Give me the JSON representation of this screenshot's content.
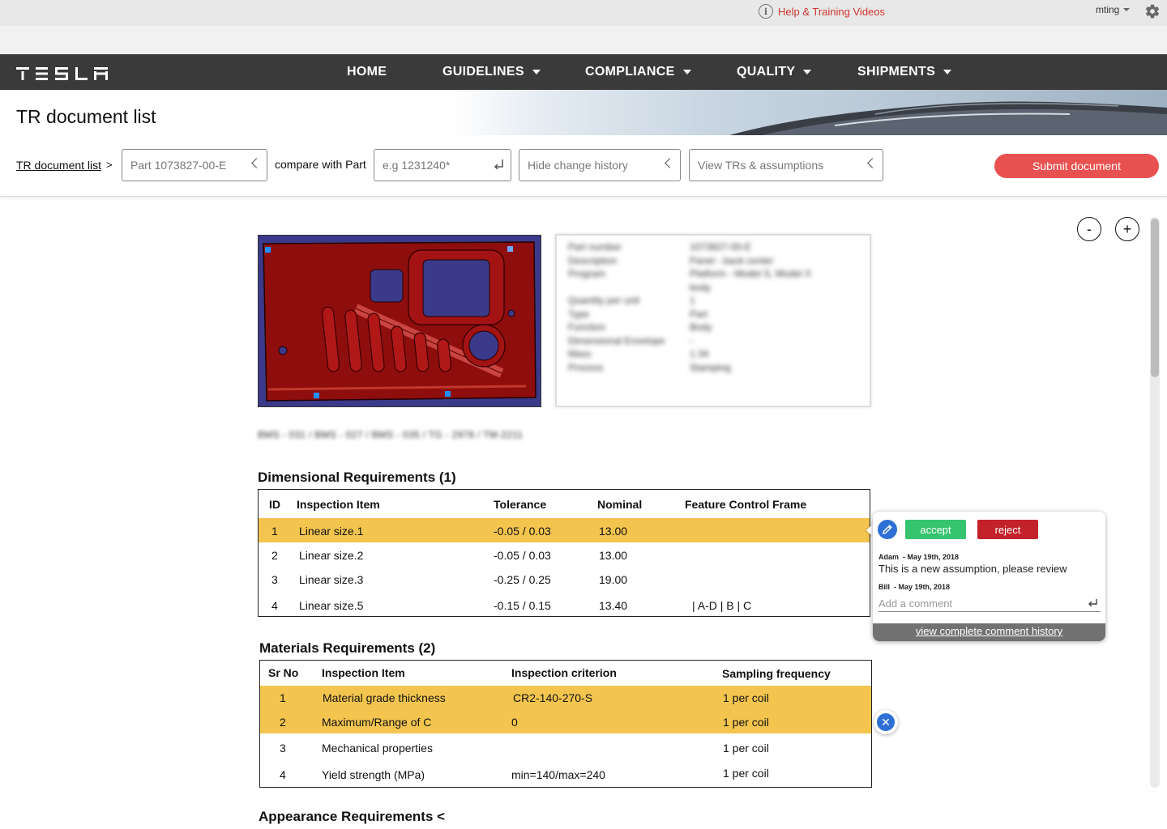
{
  "utilbar": {
    "help_label": "Help & Training Videos",
    "username": "mting"
  },
  "nav": {
    "brand": "TESLA",
    "items": [
      {
        "label": "HOME",
        "has_dropdown": false
      },
      {
        "label": "GUIDELINES",
        "has_dropdown": true
      },
      {
        "label": "COMPLIANCE",
        "has_dropdown": true
      },
      {
        "label": "QUALITY",
        "has_dropdown": true
      },
      {
        "label": "SHIPMENTS",
        "has_dropdown": true
      }
    ]
  },
  "page": {
    "title": "TR document list"
  },
  "toolbar": {
    "breadcrumb": "TR document list",
    "breadcrumb_sep": ">",
    "part_field": "Part 1073827-00-E",
    "compare_label": "compare with Part",
    "compare_placeholder": "e.g 1231240*",
    "history_select": "Hide change history",
    "view_select": "View TRs & assumptions",
    "submit_label": "Submit document"
  },
  "zoom": {
    "out_label": "-",
    "in_label": "+"
  },
  "part_info": {
    "rows": [
      [
        "Part number",
        "1073827-00-E"
      ],
      [
        "Description",
        "Panel - back center"
      ],
      [
        "Program",
        "Platform - Model S, Model X"
      ],
      [
        "",
        "body"
      ],
      [
        "Quantity per unit",
        "1"
      ],
      [
        "Type",
        "Part"
      ],
      [
        "Function",
        "Body"
      ],
      [
        "Dimensional Envelope",
        "-"
      ],
      [
        "Mass",
        "1.34"
      ],
      [
        "Process",
        "Stamping"
      ]
    ],
    "spec_line": "BMS - 031 / BMS - 027 / BMS - 035 / TG - 2978 / TM-2211"
  },
  "dimensional": {
    "title": "Dimensional Requirements (1)",
    "headers": [
      "ID",
      "Inspection Item",
      "Tolerance",
      "Nominal",
      "Feature Control Frame"
    ],
    "rows": [
      {
        "id": "1",
        "item": "Linear size.1",
        "tolerance": "-0.05  / 0.03",
        "nominal": "13.00",
        "fcf": "",
        "highlight": true
      },
      {
        "id": "2",
        "item": "Linear size.2",
        "tolerance": "-0.05  / 0.03",
        "nominal": "13.00",
        "fcf": "",
        "highlight": false
      },
      {
        "id": "3",
        "item": "Linear size.3",
        "tolerance": "-0.25  / 0.25",
        "nominal": "19.00",
        "fcf": "",
        "highlight": false
      },
      {
        "id": "4",
        "item": "Linear size.5",
        "tolerance": "-0.15 / 0.15",
        "nominal": "13.40",
        "fcf": "| A-D | B | C",
        "highlight": false
      }
    ]
  },
  "materials": {
    "title": "Materials Requirements (2)",
    "headers": [
      "Sr No",
      "Inspection Item",
      "Inspection criterion",
      "Sampling frequency"
    ],
    "rows": [
      {
        "sr": "1",
        "item": "Material grade thickness",
        "criterion": "CR2-140-270-S",
        "frequency": "1 per coil",
        "highlight": true
      },
      {
        "sr": "2",
        "item": "Maximum/Range of C",
        "criterion": "0",
        "frequency": "1 per coil",
        "highlight": true
      },
      {
        "sr": "3",
        "item": "Mechanical properties",
        "criterion": "",
        "frequency": "1 per coil",
        "highlight": false
      },
      {
        "sr": "4",
        "item": "Yield strength (MPa)",
        "criterion": "min=140/max=240",
        "frequency": "1 per coil",
        "highlight": false
      }
    ]
  },
  "appearance": {
    "title": "Appearance Requirements <"
  },
  "comment_popover": {
    "accept_label": "accept",
    "reject_label": "reject",
    "comments": [
      {
        "author": "Adam",
        "date": "May 19th, 2018",
        "text": "This is a new assumption, please review"
      },
      {
        "author": "Bill",
        "date": "May 19th, 2018",
        "text": ""
      }
    ],
    "input_placeholder": "Add a comment",
    "history_link": "view complete comment history"
  },
  "colors": {
    "highlight": "#f3c54f",
    "accept": "#36c46e",
    "reject": "#c4222a",
    "submit": "#e8514f",
    "nav_bg": "#3a3a3a",
    "help_link": "#d0352e",
    "action_blue": "#2e6fd6"
  },
  "icons": {
    "help": "info-icon",
    "settings": "gear-icon",
    "edit": "pencil-icon",
    "close": "close-icon",
    "enter": "enter-icon"
  }
}
